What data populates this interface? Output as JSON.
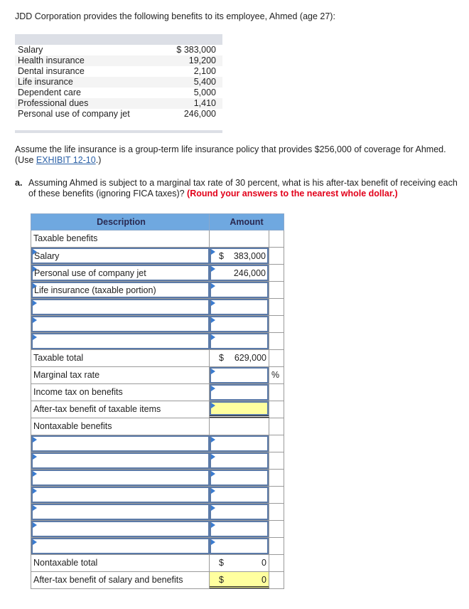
{
  "intro": "JDD Corporation provides the following benefits to its employee, Ahmed (age 27):",
  "given_benefits": [
    {
      "label": "Salary",
      "amount": "$ 383,000"
    },
    {
      "label": "Health insurance",
      "amount": "19,200"
    },
    {
      "label": "Dental insurance",
      "amount": "2,100"
    },
    {
      "label": "Life insurance",
      "amount": "5,400"
    },
    {
      "label": "Dependent care",
      "amount": "5,000"
    },
    {
      "label": "Professional dues",
      "amount": "1,410"
    },
    {
      "label": "Personal use of company jet",
      "amount": "246,000"
    }
  ],
  "assumption": {
    "text": "Assume the life insurance is a group-term life insurance policy that provides $256,000 of coverage for Ahmed. (Use ",
    "link": "EXHIBIT 12-10",
    "suffix": ".)"
  },
  "question": {
    "label": "a.",
    "text": "Assuming Ahmed is subject to a marginal tax rate of 30 percent, what is his after-tax benefit of receiving each of these benefits (ignoring FICA taxes)? ",
    "instruction": "(Round your answers to the nearest whole dollar.)"
  },
  "answer_table": {
    "headers": {
      "description": "Description",
      "amount": "Amount"
    },
    "taxable_header": "Taxable benefits",
    "taxable_rows": [
      {
        "description": "Salary",
        "dollar": "$",
        "amount": "383,000"
      },
      {
        "description": "Personal use of company jet",
        "dollar": "",
        "amount": "246,000"
      },
      {
        "description": "Life insurance (taxable portion)",
        "dollar": "",
        "amount": ""
      },
      {
        "description": "",
        "dollar": "",
        "amount": ""
      },
      {
        "description": "",
        "dollar": "",
        "amount": ""
      },
      {
        "description": "",
        "dollar": "",
        "amount": ""
      }
    ],
    "taxable_total": {
      "label": "Taxable total",
      "dollar": "$",
      "amount": "629,000"
    },
    "marginal_rate": {
      "label": "Marginal tax rate",
      "value": "",
      "unit": "%"
    },
    "income_tax": {
      "label": "Income tax on benefits",
      "value": ""
    },
    "after_tax_taxable": {
      "label": "After-tax benefit of taxable items",
      "value": ""
    },
    "nontaxable_header": "Nontaxable benefits",
    "nontaxable_rows": [
      {
        "description": "",
        "amount": ""
      },
      {
        "description": "",
        "amount": ""
      },
      {
        "description": "",
        "amount": ""
      },
      {
        "description": "",
        "amount": ""
      },
      {
        "description": "",
        "amount": ""
      },
      {
        "description": "",
        "amount": ""
      },
      {
        "description": "",
        "amount": ""
      }
    ],
    "nontaxable_total": {
      "label": "Nontaxable total",
      "dollar": "$",
      "amount": "0"
    },
    "after_tax_total": {
      "label": "After-tax benefit of salary and benefits",
      "dollar": "$",
      "amount": "0"
    }
  }
}
